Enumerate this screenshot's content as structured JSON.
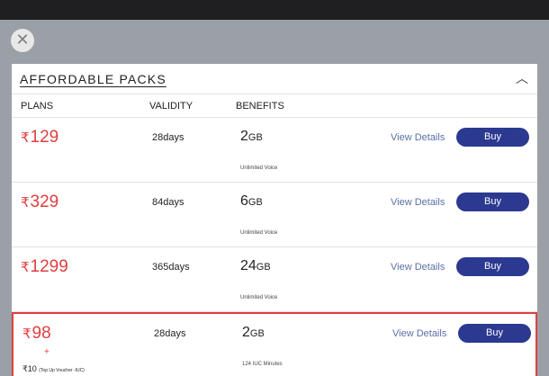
{
  "close_icon": "close-icon",
  "section": {
    "title": "AFFORDABLE PACKS",
    "collapse_icon": "chevron-up-icon"
  },
  "columns": {
    "plans": "PLANS",
    "validity": "VALIDITY",
    "benefits": "BENEFITS"
  },
  "currency": "₹",
  "view_details_label": "View Details",
  "buy_label": "Buy",
  "plans": [
    {
      "price": "129",
      "validity": "28days",
      "data_amount": "2",
      "data_unit": "GB",
      "sub": "Unlimited Voice"
    },
    {
      "price": "329",
      "validity": "84days",
      "data_amount": "6",
      "data_unit": "GB",
      "sub": "Unlimited Voice"
    },
    {
      "price": "1299",
      "validity": "365days",
      "data_amount": "24",
      "data_unit": "GB",
      "sub": "Unlimited Voice"
    },
    {
      "price": "98",
      "validity": "28days",
      "data_amount": "2",
      "data_unit": "GB",
      "sub": "124 IUC Minutes",
      "plus": "+",
      "addon_price": "₹10",
      "addon_note": "(Top Up Voucher -IUC)"
    }
  ],
  "colors": {
    "price": "#e03e3e",
    "buy_button": "#2b3990",
    "link": "#5a6fa8",
    "highlight_border": "#e03e3e"
  }
}
